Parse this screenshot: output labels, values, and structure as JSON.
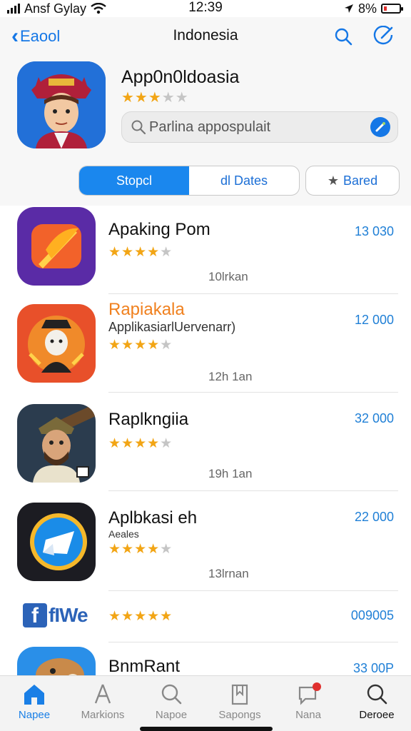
{
  "status_bar": {
    "carrier": "Ansf Gylay",
    "time": "12:39",
    "battery": "8%"
  },
  "header": {
    "back_label": "Eaool",
    "title": "Indonesia",
    "search_icon": "search-icon",
    "compose_icon": "compose-icon"
  },
  "hero": {
    "app_name": "App0n0ldoasia",
    "rating": 3.5,
    "search_placeholder": "Parlina appospulait",
    "segments": [
      "Stopcl",
      "dl Dates"
    ],
    "active_segment": 0,
    "bared_label": "Bared"
  },
  "apps": [
    {
      "title": "Apaking Pom",
      "subtitle": "",
      "rating": 4,
      "meta": "10lrkan",
      "price": "13 030",
      "title_color": "#111111"
    },
    {
      "title": "Rapiakala",
      "subtitle": "ApplikasiarlUervenarr)",
      "rating": 3.5,
      "meta": "12h 1an",
      "price": "12 000",
      "title_color": "#f0801e"
    },
    {
      "title": "Raplkngiia",
      "subtitle": "",
      "rating": 4,
      "meta": "19h 1an",
      "price": "32 000",
      "title_color": "#111111"
    },
    {
      "title": "Aplbkasi eh",
      "subtitle": "Aeales",
      "rating": 3.5,
      "meta": "13lrnan",
      "price": "22 000",
      "title_color": "#111111"
    },
    {
      "title": "fIWe",
      "subtitle": "",
      "rating": 4.5,
      "meta": "",
      "price": "009005",
      "title_color": "#2c63b8"
    },
    {
      "title": "BnmRant",
      "subtitle": "",
      "rating": 0,
      "meta": "",
      "price": "33 00P",
      "title_color": "#111111"
    }
  ],
  "tabbar": {
    "tabs": [
      {
        "label": "Napee",
        "icon": "home-icon"
      },
      {
        "label": "Markions",
        "icon": "explore-icon"
      },
      {
        "label": "Napoe",
        "icon": "search-icon"
      },
      {
        "label": "Sapongs",
        "icon": "bookmark-icon"
      },
      {
        "label": "Nana",
        "icon": "chat-icon"
      },
      {
        "label": "Deroee",
        "icon": "search-icon"
      }
    ]
  },
  "colors": {
    "accent": "#1a87ee",
    "star": "#f2a515",
    "price": "#1f7fd6"
  }
}
